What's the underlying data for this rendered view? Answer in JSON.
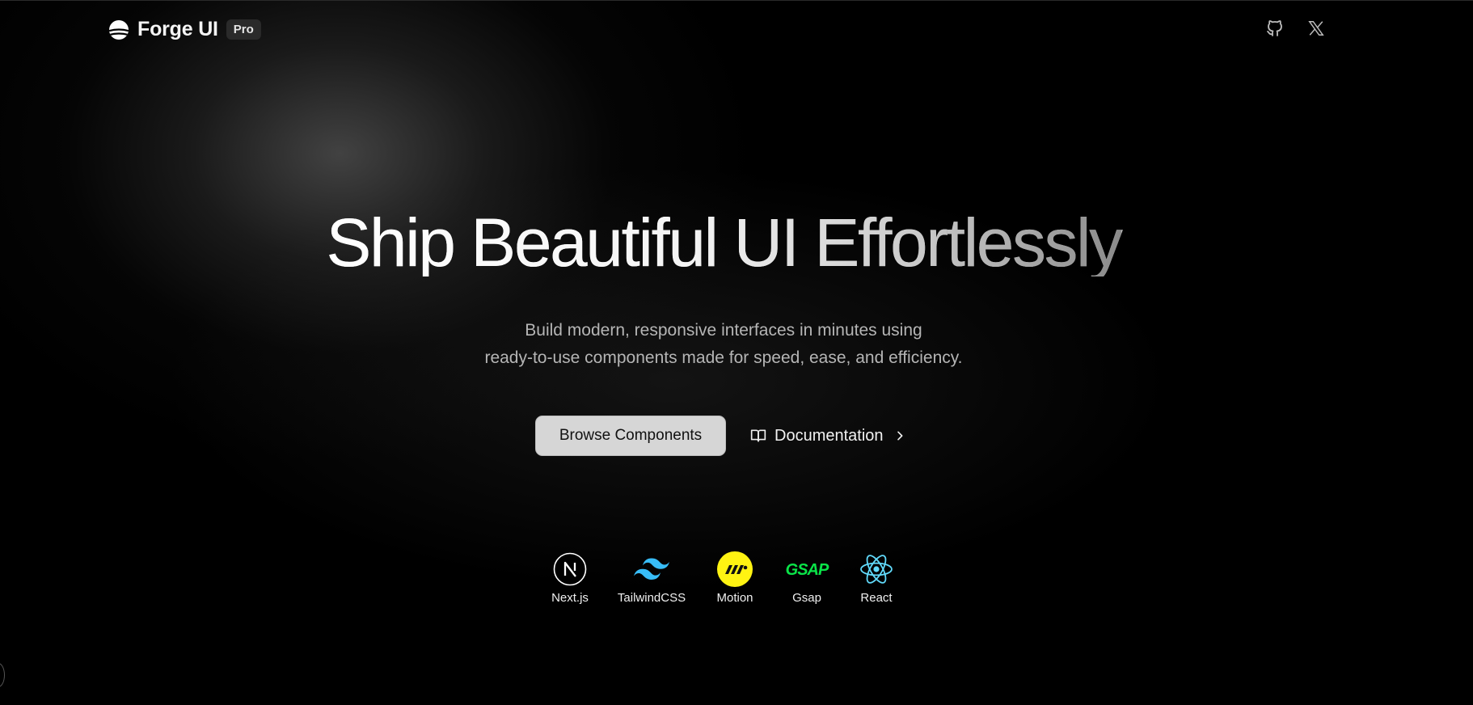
{
  "header": {
    "brand": "Forge UI",
    "badge": "Pro",
    "logo_icon": "forge-logo-icon",
    "social": [
      {
        "name": "github",
        "icon": "github-icon"
      },
      {
        "name": "x",
        "icon": "x-icon"
      }
    ]
  },
  "hero": {
    "title": "Ship Beautiful UI Effortlessly",
    "subtitle_line1": "Build modern, responsive interfaces in minutes using",
    "subtitle_line2": "ready-to-use components made for speed, ease, and efficiency."
  },
  "actions": {
    "primary_label": "Browse Components",
    "docs_label": "Documentation",
    "docs_icon": "book-icon",
    "docs_chevron": "chevron-right-icon"
  },
  "tech_stack": [
    {
      "label": "Next.js",
      "icon": "nextjs-icon"
    },
    {
      "label": "TailwindCSS",
      "icon": "tailwindcss-icon"
    },
    {
      "label": "Motion",
      "icon": "motion-icon"
    },
    {
      "label": "Gsap",
      "icon": "gsap-icon"
    },
    {
      "label": "React",
      "icon": "react-icon"
    }
  ],
  "colors": {
    "background": "#000000",
    "primary_button": "#d6d6d6",
    "tailwind": "#38bdf8",
    "motion": "#fff312",
    "gsap": "#0ae448",
    "react": "#61dafb"
  }
}
